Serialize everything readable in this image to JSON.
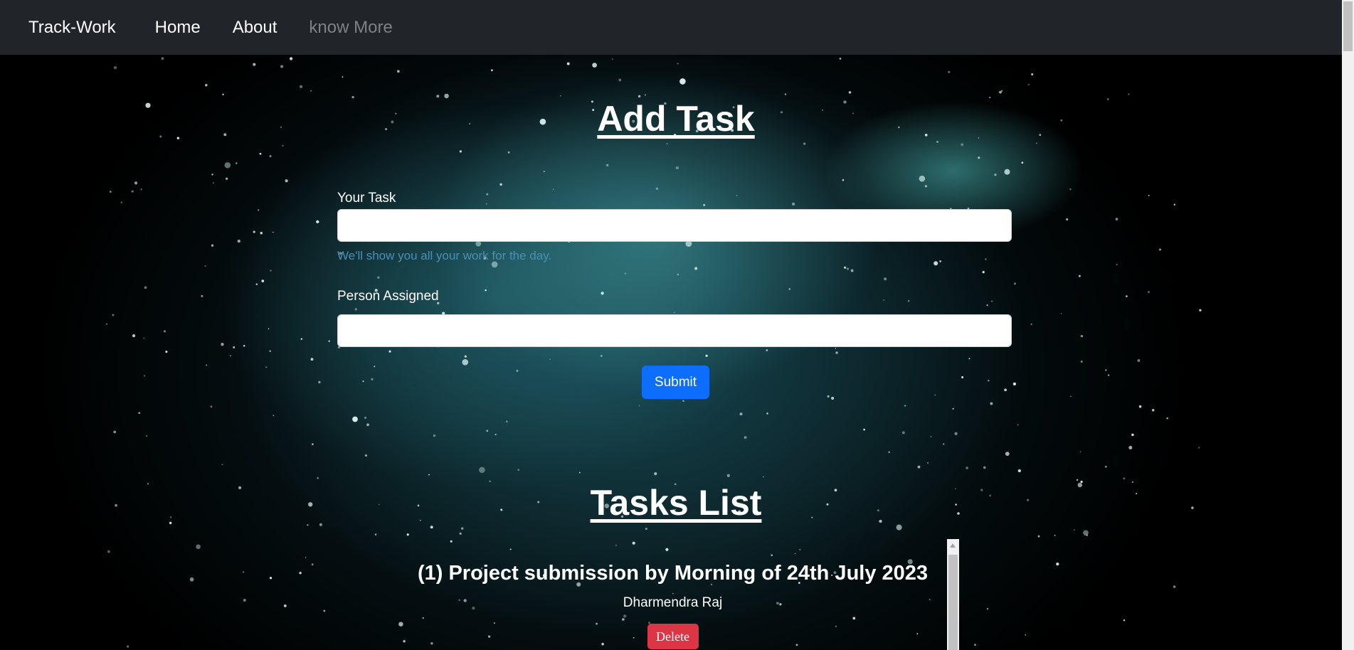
{
  "navbar": {
    "brand": "Track-Work",
    "links": [
      {
        "label": "Home"
      },
      {
        "label": "About"
      },
      {
        "label": "know More"
      }
    ]
  },
  "form": {
    "heading": "Add Task",
    "task_label": "Your Task",
    "task_value": "",
    "task_help": "We'll show you all your work for the day.",
    "person_label": "Person Assigned",
    "person_value": "",
    "submit_label": "Submit"
  },
  "tasks": {
    "heading": "Tasks List",
    "items": [
      {
        "title": "(1) Project submission by Morning of 24th July 2023",
        "person": "Dharmendra Raj",
        "delete_label": "Delete"
      }
    ]
  },
  "colors": {
    "navbar_bg": "#212529",
    "submit_bg": "#0d6efd",
    "delete_bg": "#dc3545",
    "help_text": "#4d8fb3",
    "muted_link": "#7d8288"
  }
}
